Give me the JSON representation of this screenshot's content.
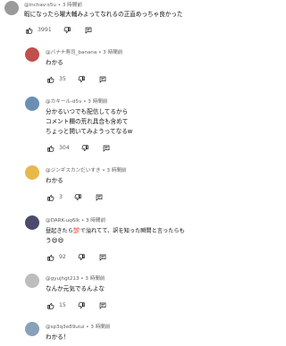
{
  "comments": [
    {
      "handle": "@inchav-s5u",
      "time": "3 時間前",
      "lines": [
        "暇になったら曜大輔みよってなれるの正直めっちゃ良かった"
      ],
      "likes": "3991",
      "avatar_color": "#9a9a9a",
      "avatar_icon": "photo-avatar"
    },
    {
      "handle": "@バナナ寿司_banana",
      "time": "3 時間前",
      "lines": [
        "わかる"
      ],
      "likes": "35",
      "avatar_color": "#c0504d",
      "avatar_icon": "photo-avatar"
    },
    {
      "handle": "@カキール-d5v",
      "time": "3 時間前",
      "lines": [
        "分かるいつでも配信してるから",
        "コメント欄の荒れ具合も含めて",
        "ちょっと開いてみようってなるw"
      ],
      "likes": "304",
      "avatar_color": "#6b8fb3",
      "avatar_icon": "photo-avatar"
    },
    {
      "handle": "@ジンギスカンだいすき",
      "time": "3 時間前",
      "lines": [
        "わかる"
      ],
      "likes": "3",
      "avatar_color": "#e8b84a",
      "avatar_icon": "emoji-avatar"
    },
    {
      "handle": "@DARK-uq6lk",
      "time": "3 時間前",
      "lines": [
        "昼起きたら💯で溢れてて、訳を知った瞬間と言ったらも",
        "う😄😄"
      ],
      "likes": "92",
      "avatar_color": "#4a4a6a",
      "avatar_icon": "photo-avatar"
    },
    {
      "handle": "@gyujhgt213",
      "time": "3 時間前",
      "lines": [
        "なんか元気でるんよな"
      ],
      "likes": "15",
      "avatar_color": "#bdbdbd",
      "avatar_icon": "default-avatar"
    },
    {
      "handle": "@sp3q3e89uiui",
      "time": "3 時間前",
      "lines": [
        "わかる！"
      ],
      "likes": "",
      "avatar_color": "#8aa0b8",
      "avatar_icon": "photo-avatar"
    }
  ],
  "icons": {
    "like": "thumbs-up-icon",
    "dislike": "thumbs-down-icon",
    "reply": "reply-icon"
  }
}
